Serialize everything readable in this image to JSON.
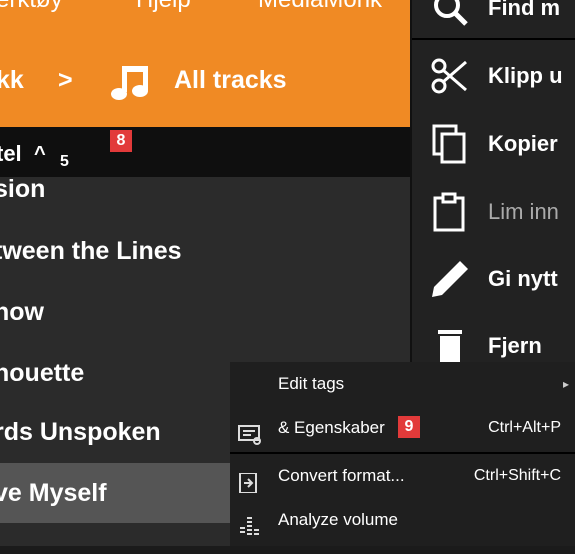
{
  "menubar": {
    "items": [
      "erktøy",
      "Hjelp",
      "MediaMonk"
    ]
  },
  "breadcrumb": {
    "parent": "kk",
    "separator": ">",
    "current": "All tracks"
  },
  "column_header": {
    "label": "tel",
    "sort_indicator": "^",
    "count": "5"
  },
  "callouts": {
    "eight": "8",
    "nine": "9"
  },
  "tracks": [
    {
      "title": "sion"
    },
    {
      "title": "tween the Lines"
    },
    {
      "title": "now"
    },
    {
      "title": "houette"
    },
    {
      "title": "rds Unspoken"
    },
    {
      "title": "ve Myself"
    }
  ],
  "context_menu": {
    "items": [
      {
        "label": "Find m",
        "icon": "search-icon"
      },
      {
        "label": "Klipp u",
        "icon": "scissors-icon"
      },
      {
        "label": "Kopier",
        "icon": "copy-icon"
      },
      {
        "label": "Lim inn",
        "icon": "clipboard-icon",
        "disabled": true
      },
      {
        "label": "Gi nytt",
        "icon": "pencil-icon"
      },
      {
        "label": "Fjern",
        "icon": "trash-icon"
      }
    ]
  },
  "submenu": {
    "items": [
      {
        "label": "Edit tags",
        "shortcut": "",
        "has_arrow": true
      },
      {
        "label": "& Egenskaber",
        "shortcut": "Ctrl+Alt+P",
        "icon": "properties-icon"
      },
      {
        "label": "Convert format...",
        "shortcut": "Ctrl+Shift+C",
        "icon": "convert-icon"
      },
      {
        "label": "Analyze volume",
        "shortcut": "",
        "icon": "volume-bars-icon"
      }
    ]
  },
  "colors": {
    "accent": "#f08a24",
    "badge": "#e23a3a",
    "list_bg": "#2b2b2b",
    "selected_row": "#555555"
  }
}
